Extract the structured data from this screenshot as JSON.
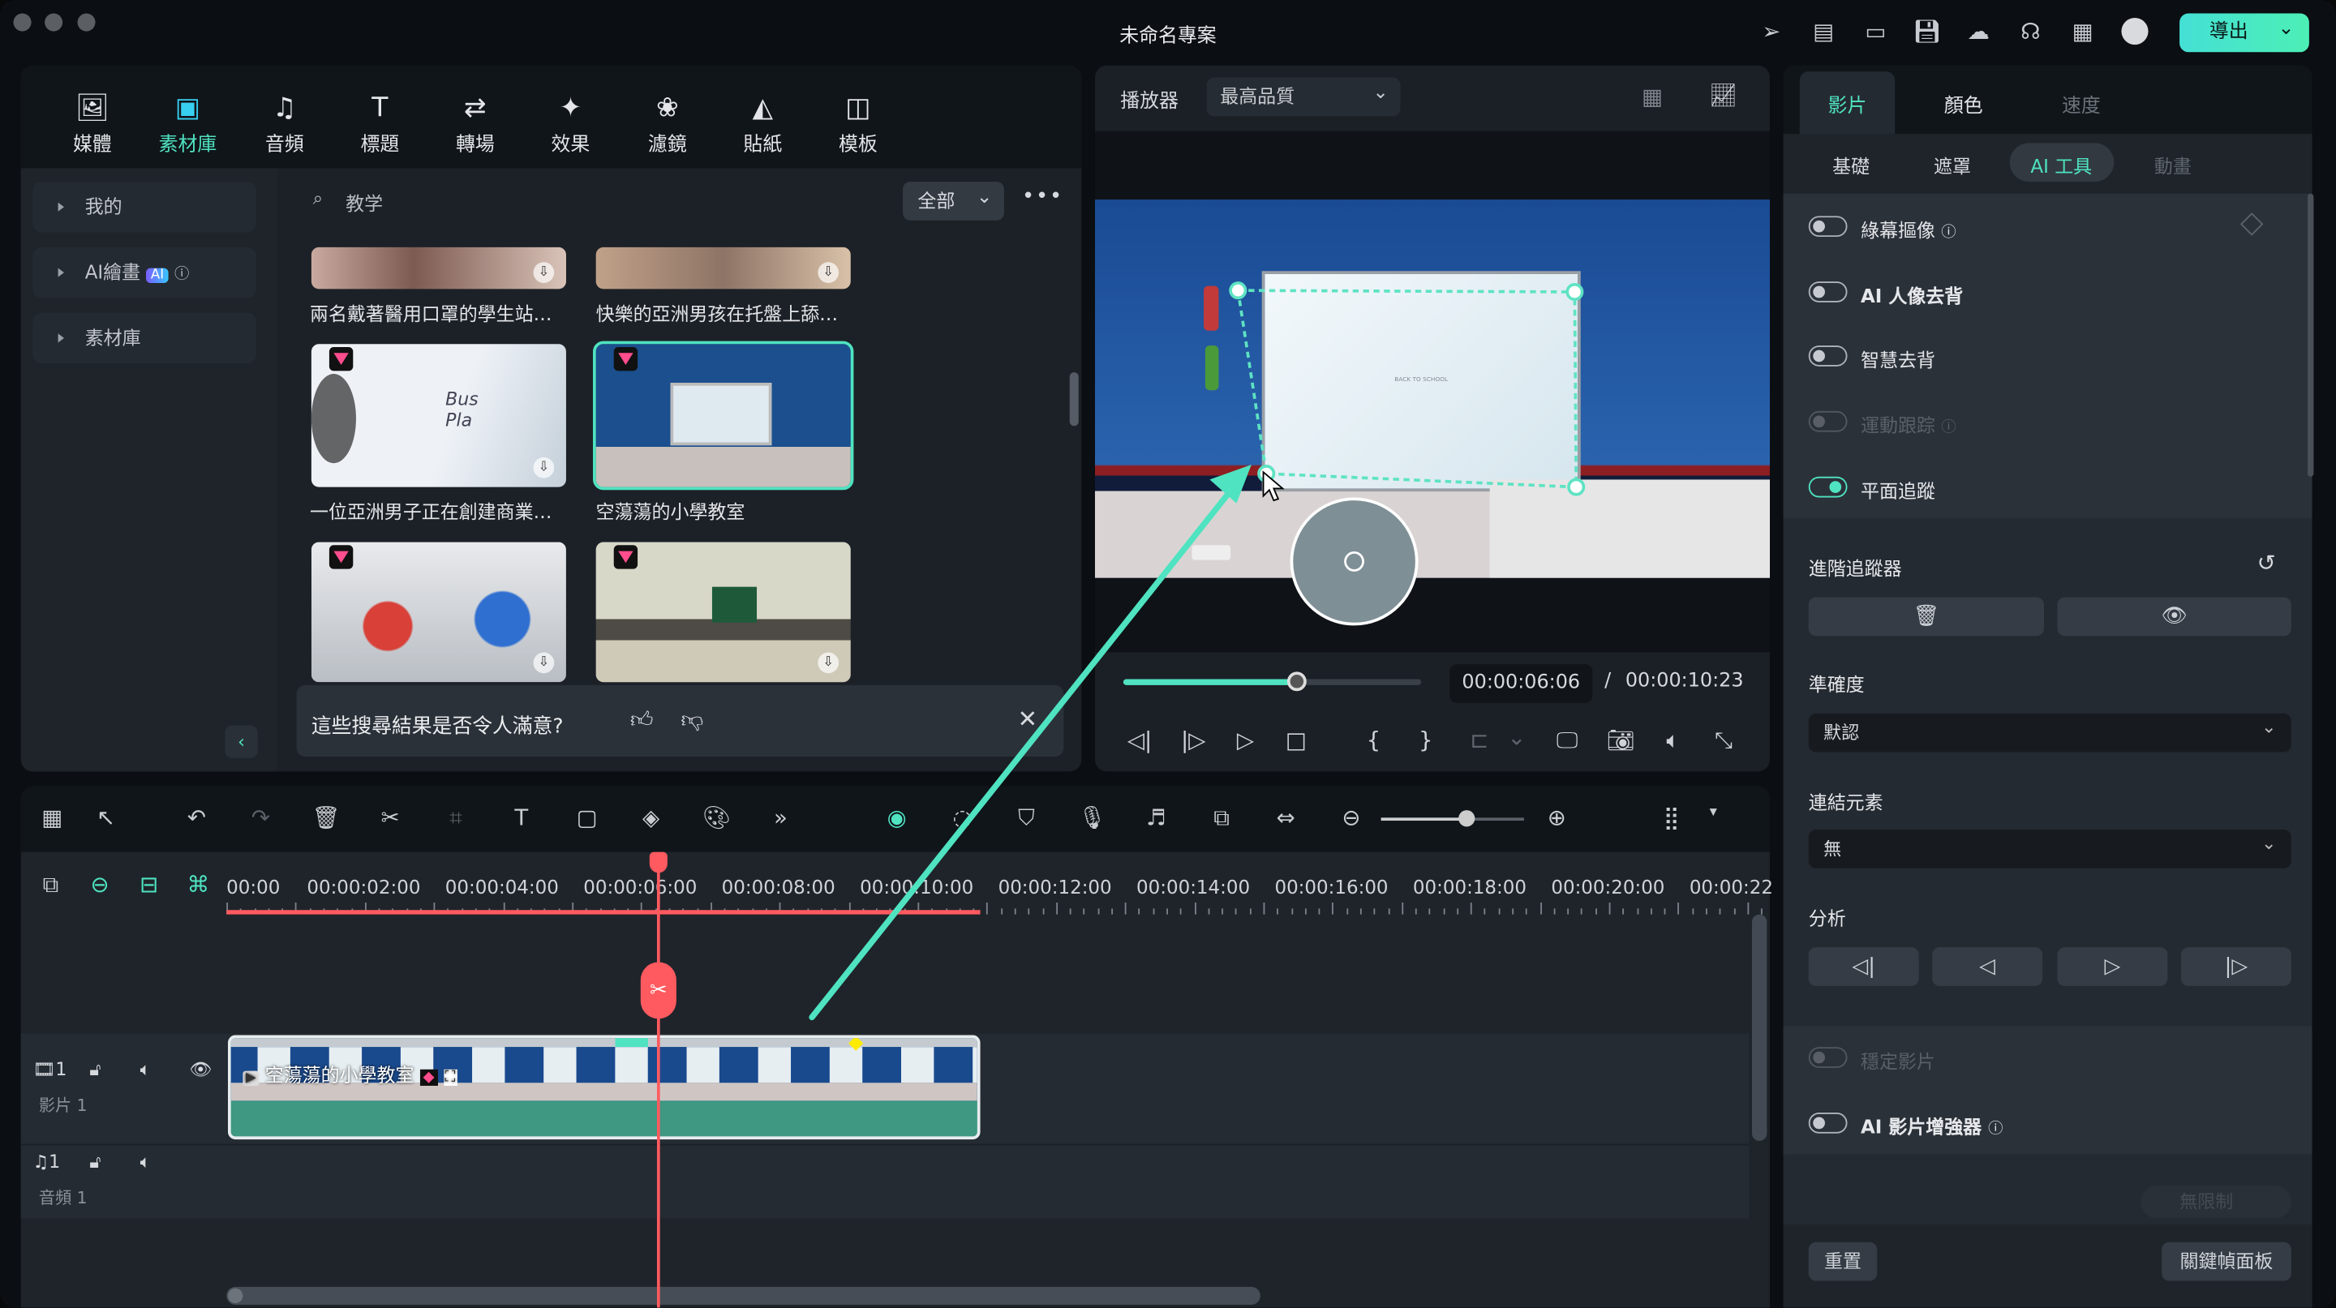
{
  "window": {
    "title": "未命名專案",
    "export_label": "導出",
    "accent": "#4fe3c1",
    "playhead_color": "#ff5a5f"
  },
  "titlebar_icons": [
    "send-icon",
    "task-list-icon",
    "layout-icon",
    "save-icon",
    "cloud-icon",
    "headset-icon",
    "apps-grid-icon",
    "avatar"
  ],
  "media_tabs": [
    {
      "label": "媒體",
      "icon": "media-icon"
    },
    {
      "label": "素材庫",
      "icon": "stock-folder-icon",
      "active": true
    },
    {
      "label": "音頻",
      "icon": "music-icon"
    },
    {
      "label": "標題",
      "icon": "title-icon"
    },
    {
      "label": "轉場",
      "icon": "transition-icon"
    },
    {
      "label": "效果",
      "icon": "effects-icon"
    },
    {
      "label": "濾鏡",
      "icon": "filter-icon"
    },
    {
      "label": "貼紙",
      "icon": "sticker-icon"
    },
    {
      "label": "模板",
      "icon": "template-icon"
    }
  ],
  "sidebar": {
    "items": [
      {
        "label": "我的"
      },
      {
        "label": "AI繪畫",
        "badge": "AI"
      },
      {
        "label": "素材庫"
      }
    ]
  },
  "search": {
    "value": "教学",
    "filter": "全部"
  },
  "library": {
    "items": [
      {
        "caption": "兩名戴著醫用口罩的學生站…"
      },
      {
        "caption": "快樂的亞洲男孩在托盤上舔…"
      },
      {
        "caption": "一位亞洲男子正在創建商業…"
      },
      {
        "caption": "空蕩蕩的小學教室"
      },
      {
        "caption": ""
      },
      {
        "caption": ""
      }
    ]
  },
  "feedback": {
    "question": "這些搜尋結果是否令人滿意?"
  },
  "player": {
    "label": "播放器",
    "quality": "最高品質",
    "current_time": "00:00:06:06",
    "separator": "/",
    "total_time": "00:00:10:23",
    "progress_percent": 58,
    "video_text": "BACK TO SCHOOL"
  },
  "right_panel": {
    "tabs": [
      {
        "label": "影片",
        "active": true
      },
      {
        "label": "顏色"
      },
      {
        "label": "速度",
        "disabled": true
      }
    ],
    "subtabs": [
      {
        "label": "基礎"
      },
      {
        "label": "遮罩"
      },
      {
        "label": "AI 工具",
        "active": true
      },
      {
        "label": "動畫",
        "disabled": true
      }
    ],
    "toggles": [
      {
        "label": "綠幕摳像",
        "on": false,
        "help": true
      },
      {
        "label": "AI 人像去背",
        "on": false
      },
      {
        "label": "智慧去背",
        "on": false
      },
      {
        "label": "運動跟踪",
        "on": false,
        "disabled": true,
        "help": true
      },
      {
        "label": "平面追蹤",
        "on": true
      }
    ],
    "tracker_label": "進階追蹤器",
    "accuracy_label": "準確度",
    "accuracy_value": "默認",
    "link_label": "連結元素",
    "link_value": "無",
    "analyze_label": "分析",
    "stabilize": {
      "label": "穩定影片",
      "on": false,
      "disabled": true
    },
    "enhancer": {
      "label": "AI 影片增強器",
      "on": false,
      "help": true
    },
    "unlimited_label": "無限制",
    "reset_label": "重置",
    "keyframe_label": "關鍵幀面板"
  },
  "timeline": {
    "ruler": [
      "00:00",
      "00:00:02:00",
      "00:00:04:00",
      "00:00:06:00",
      "00:00:08:00",
      "00:00:10:00",
      "00:00:12:00",
      "00:00:14:00",
      "00:00:16:00",
      "00:00:18:00",
      "00:00:20:00",
      "00:00:22"
    ],
    "playhead_time": "00:00:06:06",
    "clip_title": "空蕩蕩的小學教室",
    "tracks": [
      {
        "number": "1",
        "name": "影片 1"
      },
      {
        "number": "1",
        "name": "音頻 1"
      }
    ]
  }
}
